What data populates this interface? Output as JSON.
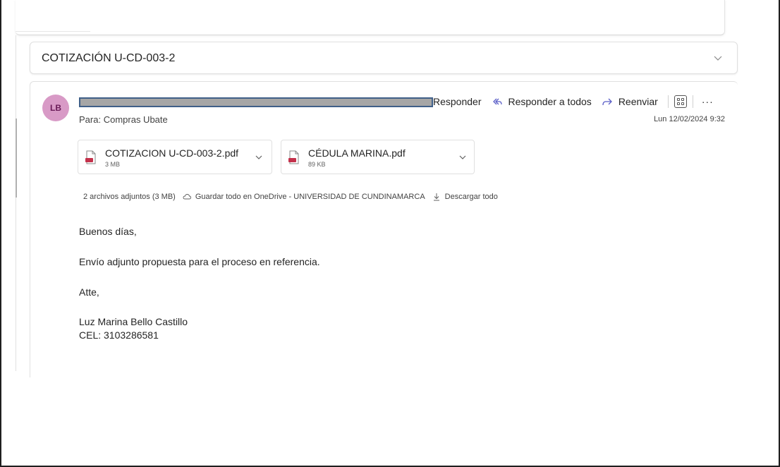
{
  "subject": "COTIZACIÓN U-CD-003-2",
  "message": {
    "avatar_initials": "LB",
    "actions": {
      "reply": "Responder",
      "reply_all": "Responder a todos",
      "forward": "Reenviar",
      "more": "···"
    },
    "to_label": "Para:",
    "to_value": "Compras Ubate",
    "date": "Lun 12/02/2024 9:32",
    "attachments": [
      {
        "name": "COTIZACION U-CD-003-2.pdf",
        "size": "3 MB"
      },
      {
        "name": "CÉDULA MARINA.pdf",
        "size": "89 KB"
      }
    ],
    "attachments_summary": "2 archivos adjuntos (3 MB)",
    "save_onedrive": "Guardar todo en OneDrive - UNIVERSIDAD DE CUNDINAMARCA",
    "download_all": "Descargar todo",
    "body": {
      "greeting": "Buenos días,",
      "line1": "Envío adjunto propuesta para el proceso en referencia.",
      "closing": "Atte,",
      "signature_name": "Luz Marina Bello Castillo",
      "signature_phone": "CEL: 3103286581"
    }
  },
  "colors": {
    "avatar_bg": "#d89ac6",
    "accent_blue": "#0f6cbd",
    "pdf_red": "#c4314b"
  }
}
